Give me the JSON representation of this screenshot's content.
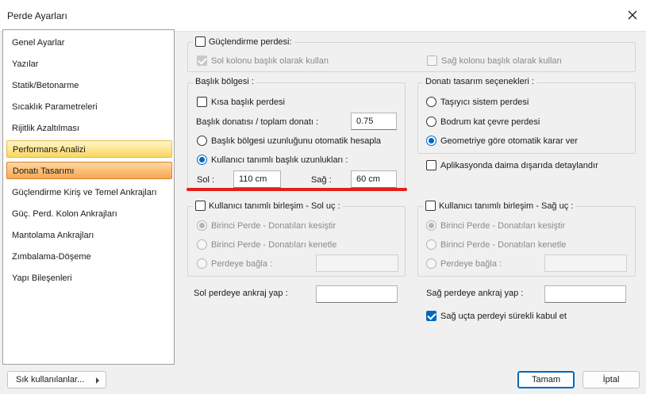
{
  "window": {
    "title": "Perde Ayarları",
    "close_icon": "close-icon"
  },
  "sidebar": {
    "items": [
      {
        "label": "Genel Ayarlar"
      },
      {
        "label": "Yazılar"
      },
      {
        "label": "Statik/Betonarme"
      },
      {
        "label": "Sıcaklık Parametreleri"
      },
      {
        "label": "Rijitlik Azaltılması"
      },
      {
        "label": "Performans Analizi"
      },
      {
        "label": "Donatı Tasarımı"
      },
      {
        "label": "Güçlendirme Kiriş ve Temel Ankrajları"
      },
      {
        "label": "Güç. Perd. Kolon Ankrajları"
      },
      {
        "label": "Mantolama Ankrajları"
      },
      {
        "label": "Zımbalama-Döşeme"
      },
      {
        "label": "Yapı Bileşenleri"
      }
    ],
    "highlighted": "Performans Analizi",
    "selected": "Donatı Tasarımı"
  },
  "guclendirme": {
    "label": "Güçlendirme perdesi:",
    "checked": false,
    "sol_kolon": {
      "label": "Sol kolonu başlık olarak kullan",
      "checked": true,
      "enabled": false
    },
    "sag_kolon": {
      "label": "Sağ kolonu başlık olarak kullan",
      "checked": false,
      "enabled": false
    }
  },
  "baslik": {
    "group_label": "Başlık bölgesi :",
    "kisa": {
      "label": "Kısa başlık perdesi",
      "checked": false
    },
    "oran_label": "Başlık donatısı / toplam donatı :",
    "oran_value": "0.75",
    "otomatik": {
      "label": "Başlık bölgesi uzunluğunu otomatik hesapla",
      "checked": false
    },
    "kullanici": {
      "label": "Kullanıcı tanımlı başlık uzunlukları :",
      "checked": true
    },
    "sol_label": "Sol :",
    "sol_value": "110 cm",
    "sag_label": "Sağ :",
    "sag_value": "60 cm"
  },
  "donati": {
    "group_label": "Donatı tasarım seçenekleri :",
    "options": [
      {
        "label": "Taşıyıcı sistem perdesi",
        "checked": false
      },
      {
        "label": "Bodrum kat çevre perdesi",
        "checked": false
      },
      {
        "label": "Geometriye göre otomatik karar ver",
        "checked": true
      }
    ],
    "aplikasyon": {
      "label": "Aplikasyonda daima dışarıda detaylandır",
      "checked": false
    }
  },
  "sol_birlesim": {
    "label": "Kullanıcı tanımlı birleşim - Sol uç :",
    "checked": false,
    "options": [
      {
        "label": "Birinci Perde - Donatıları kesiştir",
        "checked": true
      },
      {
        "label": "Birinci Perde - Donatıları kenetle",
        "checked": false
      },
      {
        "label": "Perdeye bağla :",
        "checked": false
      }
    ],
    "field_value": ""
  },
  "sag_birlesim": {
    "label": "Kullanıcı tanımlı birleşim - Sağ uç :",
    "checked": false,
    "options": [
      {
        "label": "Birinci Perde - Donatıları kesiştir",
        "checked": true
      },
      {
        "label": "Birinci Perde - Donatıları kenetle",
        "checked": false
      },
      {
        "label": "Perdeye bağla :",
        "checked": false
      }
    ],
    "field_value": ""
  },
  "ankraj": {
    "sol_label": "Sol perdeye ankraj yap :",
    "sol_value": "",
    "sag_label": "Sağ perdeye ankraj yap :",
    "sag_value": "",
    "surekli": {
      "label": "Sağ uçta perdeyi sürekli kabul et",
      "checked": true
    }
  },
  "footer": {
    "favorites_label": "Sık kullanılanlar...",
    "ok_label": "Tamam",
    "cancel_label": "İptal"
  },
  "colors": {
    "accent": "#0067c0",
    "highlight": "#fbd65e",
    "selected": "#f5a853",
    "annotation": "#e41e1e"
  }
}
